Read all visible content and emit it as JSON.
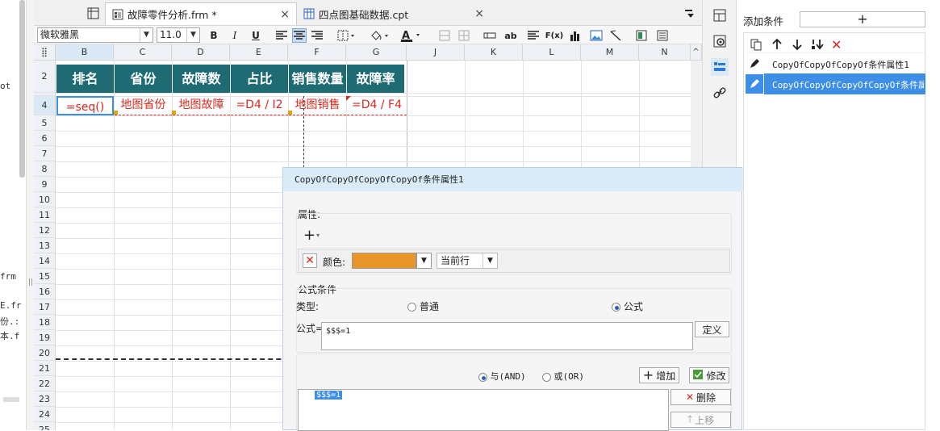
{
  "left_panel": {
    "lines": [
      "ot",
      "frm",
      "E.fr",
      "份.:",
      "本.f"
    ]
  },
  "tabs": [
    {
      "label": "故障零件分析.frm *",
      "close": "×"
    },
    {
      "label": "四点图基础数据.cpt",
      "close": "×"
    }
  ],
  "toolbar": {
    "font_name": "微软雅黑",
    "font_size": "11.0",
    "bold": "B",
    "italic": "I",
    "underline": "U",
    "text_label": "ab",
    "formula_label": "F(x)"
  },
  "grid": {
    "columns": [
      "B",
      "C",
      "D",
      "E",
      "F",
      "G",
      "J",
      "K",
      "L",
      "M",
      "N"
    ],
    "rows": [
      "2",
      "4",
      "5",
      "6",
      "7",
      "8",
      "9",
      "10",
      "11",
      "12",
      "13",
      "14",
      "15",
      "16",
      "17",
      "18",
      "19",
      "20",
      "21",
      "22",
      "23",
      "24",
      "25"
    ],
    "headers": [
      "排名",
      "省份",
      "故障数",
      "占比",
      "销售数量",
      "故障率"
    ],
    "formulas": [
      "=seq()",
      "地图省份",
      "地图故障",
      "=D4 / I2",
      "地图销售",
      "=D4 / F4"
    ]
  },
  "sidebar_right": {
    "add_condition_label": "添加条件",
    "add_symbol": "+",
    "conditions": [
      {
        "label": "CopyOfCopyOfCopyOf条件属性1",
        "selected": false
      },
      {
        "label": "CopyOfCopyOfCopyOfCopyOf条件属性",
        "selected": true
      }
    ]
  },
  "dialog": {
    "title": "CopyOfCopyOfCopyOfCopyOf条件属性1",
    "attr_section": "属性:",
    "add_attr": "+",
    "color_label": "颜色:",
    "color_value": "#e8952a",
    "scope_value": "当前行",
    "formula_section": "公式条件",
    "type_label": "类型:",
    "type_normal": "普通",
    "type_formula": "公式",
    "formula_label": "公式=",
    "formula_value": "$$$=1",
    "define_button": "定义",
    "and_label": "与(AND)",
    "or_label": "或(OR)",
    "add_button": "增加",
    "modify_button": "修改",
    "delete_button": "删除",
    "moveup_button": "上移",
    "list_item": "$$$=1"
  },
  "colors": {
    "header_teal": "#1f6b73",
    "formula_red": "#d9281e",
    "selection_blue": "#3d8ee6"
  }
}
